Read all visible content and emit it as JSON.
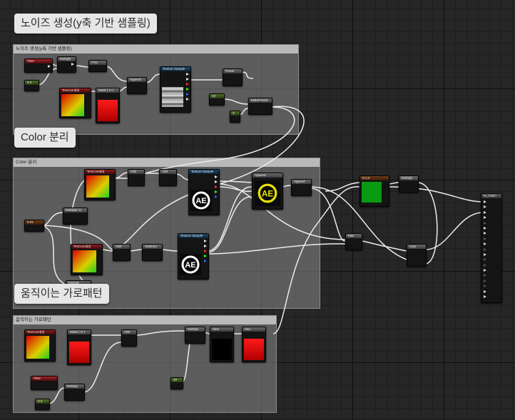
{
  "comments": [
    {
      "id": "noise",
      "bubble": "노이즈 생성(y축 기반 샘플링)",
      "header": "노이즈 생성(y축 기반 샘플링)"
    },
    {
      "id": "color",
      "bubble": "Color 분리",
      "header": "Color 분리"
    },
    {
      "id": "pattern",
      "bubble": "움직이는 가로패턴",
      "header": "움직이는 가로패턴"
    }
  ],
  "nodes": {
    "time_1": "Time",
    "multiply_1": "Multiply",
    "frac_1": "Frac",
    "const_1": "0.2",
    "texcoord_1": "TexCoord[0]",
    "mask_1": "Mask ( G )",
    "append_1": "Append",
    "texsample_1": "Texture Sample",
    "power_1": "Power",
    "const_2": "10",
    "const_3": "3",
    "makefloat": "MakeFloat3",
    "texcoord_2": "TexCoord[0]",
    "add_1": "Add",
    "add_2": "Add",
    "texsample_2": "Texture Sample",
    "append_2": "Append",
    "append_3": "Append",
    "multiply_2": "Multiply(-1)",
    "param_1": "0.01",
    "texcoord_3": "TexCoord[0]",
    "add_3": "Add",
    "subtract_1": "Subtract",
    "texsample_3": "Texture Sample",
    "multiply_3": "Multiply",
    "max_1": "Max",
    "param_green": "0,1,0",
    "multiply_4": "Multiply",
    "lerp_1": "Lerp",
    "result": "M_Glitch",
    "texcoord_4": "TexCoord[0]",
    "mask_2": "Mask ( G )",
    "add_4": "Add",
    "multiply_5": "Multiply",
    "sine": "Sine",
    "abs": "Abs",
    "time_2": "Time",
    "multiply_6": "Multiply",
    "const_4": "0.3",
    "const_5": "40"
  },
  "logo_glyph": "AE",
  "colors": {
    "comment_fill": "#808080",
    "param_green": "#0a9a14",
    "mask_red": "#ff1a1a",
    "logo_yellow": "#e8e000"
  }
}
